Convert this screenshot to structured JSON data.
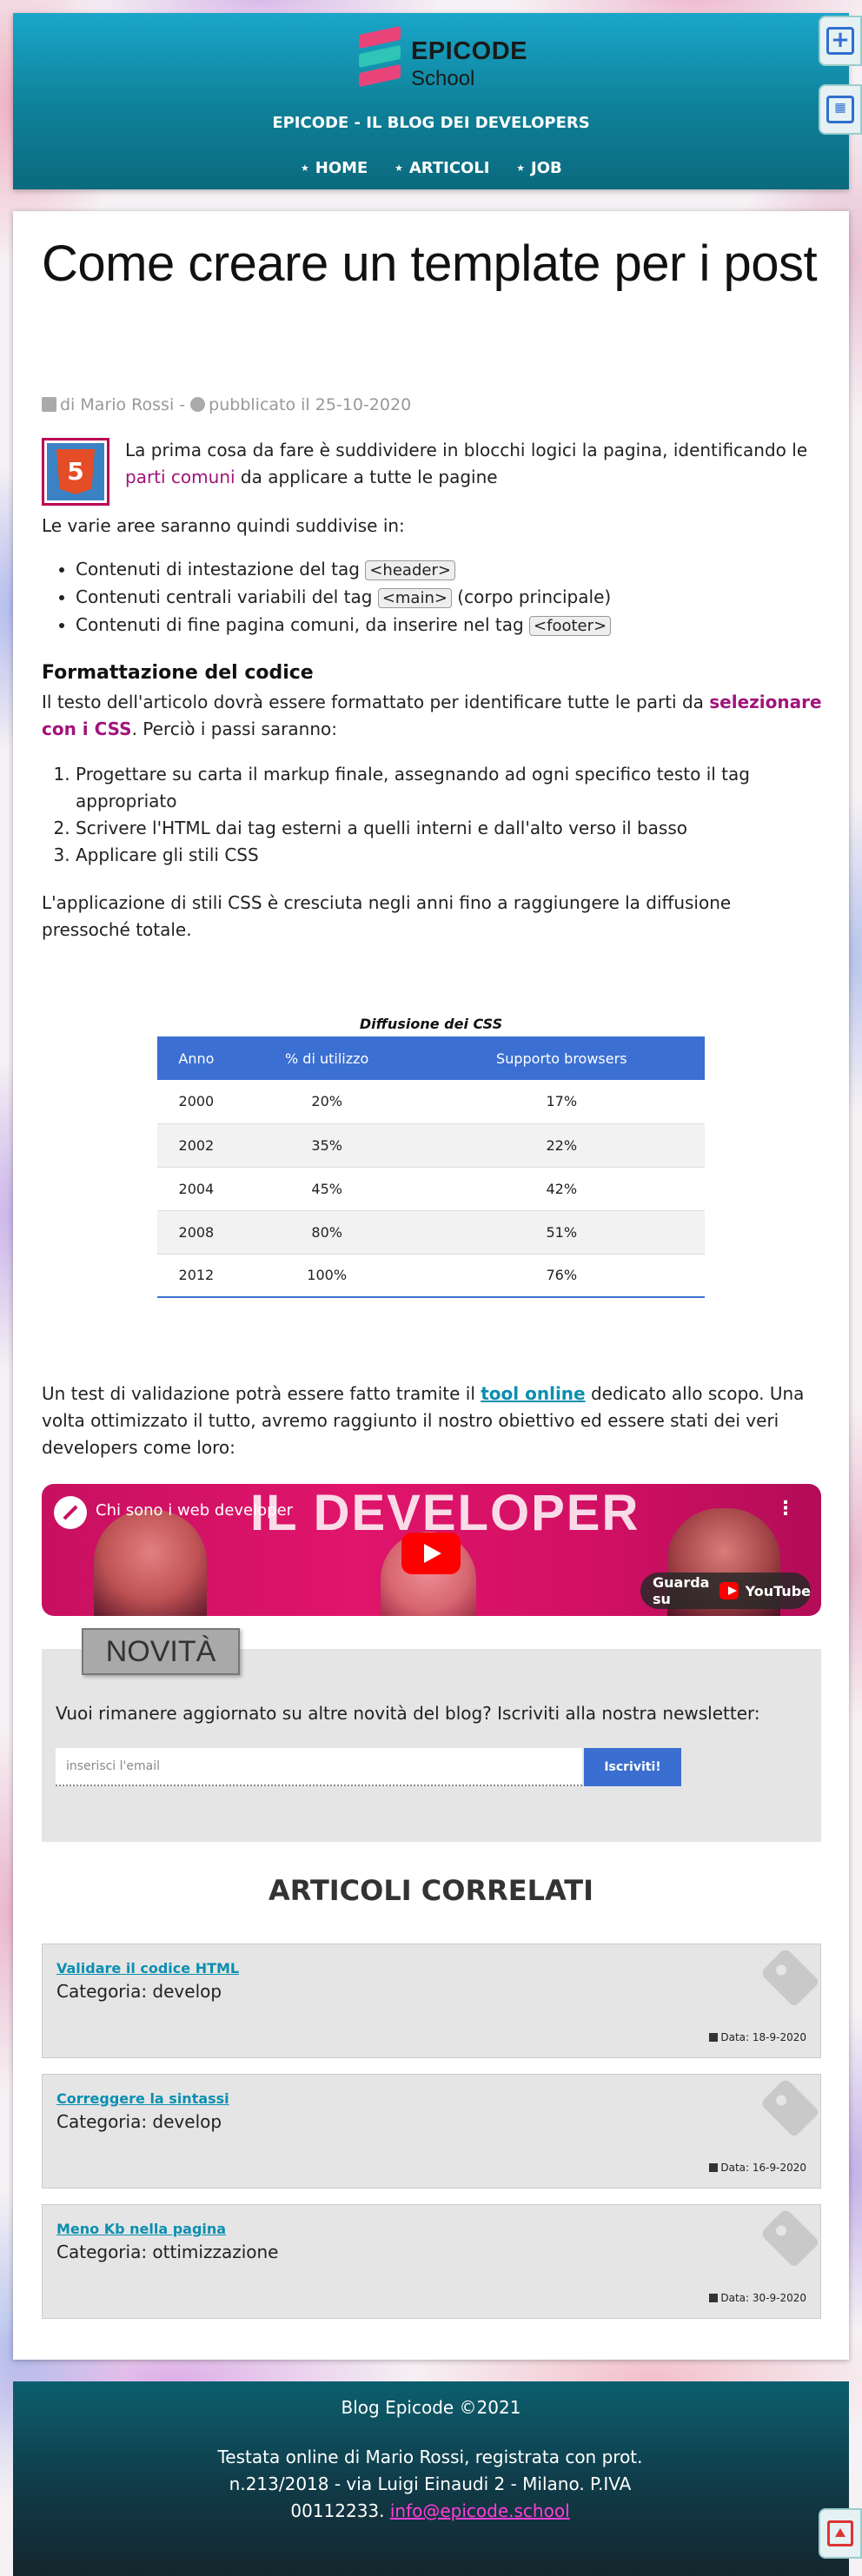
{
  "header": {
    "logo_line1": "EPICODE",
    "logo_line2": "School",
    "blog_title": "EPICODE - IL BLOG DEI DEVELOPERS",
    "nav": [
      "⋆ HOME",
      "⋆ ARTICOLI",
      "⋆ JOB"
    ]
  },
  "side_widgets": {
    "top_icon": "plus-square-icon",
    "calendar_icon": "calendar-icon",
    "back_to_top_icon": "arrow-up-square-icon"
  },
  "article": {
    "title": "Come creare un template per i post",
    "meta_author": "di Mario Rossi",
    "meta_sep": " - ",
    "meta_date": "pubblicato il 25-10-2020",
    "intro_before": "La prima cosa da fare è suddividere in blocchi logici la pagina, identificando le ",
    "intro_highlight": "parti comuni",
    "intro_after": " da applicare a tutte le pagine",
    "areas_intro": "Le varie aree saranno quindi suddivise in:",
    "areas": [
      {
        "before": "Contenuti di intestazione del tag ",
        "tag": "<header>",
        "after": ""
      },
      {
        "before": "Contenuti centrali variabili del tag ",
        "tag": "<main>",
        "after": " (corpo principale)"
      },
      {
        "before": "Contenuti di fine pagina comuni, da inserire nel tag ",
        "tag": "<footer>",
        "after": ""
      }
    ],
    "section_title": "Formattazione del codice",
    "section_before": "Il testo dell'articolo dovrà essere formattato per identificare tutte le parti da ",
    "section_highlight": "selezionare con i CSS",
    "section_after": ". Perciò i passi saranno:",
    "steps": [
      "Progettare su carta il markup finale, assegnando ad ogni specifico testo il tag appropriato",
      "Scrivere l'HTML dai tag esterni a quelli interni e dall'alto verso il basso",
      "Applicare gli stili CSS"
    ],
    "css_growth": "L'applicazione di stili CSS è cresciuta negli anni fino a raggiungere la diffusione pressoché totale.",
    "validation_before": "Un test di validazione potrà essere fatto tramite il ",
    "validation_link": "tool online",
    "validation_after": " dedicato allo scopo. Una volta ottimizzato il tutto, avremo raggiunto il nostro obiettivo ed essere stati dei veri developers come loro:"
  },
  "chart_data": {
    "type": "table",
    "title": "Diffusione dei CSS",
    "columns": [
      "Anno",
      "% di utilizzo",
      "Supporto browsers"
    ],
    "rows": [
      [
        "2000",
        "20%",
        "17%"
      ],
      [
        "2002",
        "35%",
        "22%"
      ],
      [
        "2004",
        "45%",
        "42%"
      ],
      [
        "2008",
        "80%",
        "51%"
      ],
      [
        "2012",
        "100%",
        "76%"
      ]
    ]
  },
  "video": {
    "title": "Chi sono i web developer",
    "banner_text": "IL DEVELOPER",
    "more": "⋮",
    "watch_on": "Guarda su",
    "youtube": "YouTube"
  },
  "newsletter": {
    "tag": "NOVITÀ",
    "text": "Vuoi rimanere aggiornato su altre novità del blog? Iscriviti alla nostra newsletter:",
    "placeholder": "inserisci l'email",
    "button": "Iscriviti!"
  },
  "related": {
    "title": "ARTICOLI CORRELATI",
    "items": [
      {
        "link": "Validare il codice HTML",
        "category": "Categoria: develop",
        "date": "Data: 18-9-2020"
      },
      {
        "link": "Correggere la sintassi",
        "category": "Categoria: develop",
        "date": "Data: 16-9-2020"
      },
      {
        "link": "Meno Kb nella pagina",
        "category": "Categoria: ottimizzazione",
        "date": "Data: 30-9-2020"
      }
    ]
  },
  "footer": {
    "title": "Blog Epicode ©2021",
    "text": "Testata online di Mario Rossi, registrata con prot. n.213/2018 - via Luigi Einaudi 2 - Milano. P.IVA 00112233. ",
    "email": "info@epicode.school"
  }
}
